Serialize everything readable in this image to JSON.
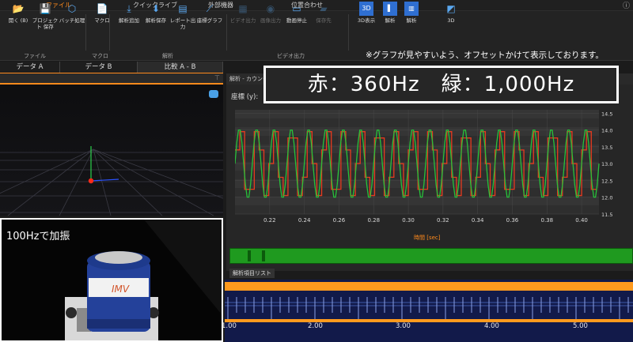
{
  "tabs": [
    "ファイル",
    "クイックライブ",
    "外部機器",
    "位置合わせ"
  ],
  "ribbon": {
    "buttons": [
      {
        "id": "open",
        "label": "開く (B)",
        "icon": "folder-open-icon"
      },
      {
        "id": "project-save",
        "label": "プロジェクト 保存",
        "icon": "save-icon"
      },
      {
        "id": "batch",
        "label": "バッチ処理",
        "icon": "cube-icon"
      },
      {
        "id": "macro",
        "label": "マクロ",
        "icon": "script-icon"
      },
      {
        "id": "add-analysis",
        "label": "解析追加",
        "icon": "download-icon"
      },
      {
        "id": "analysis-save",
        "label": "解析保存",
        "icon": "save-arrow-icon"
      },
      {
        "id": "report",
        "label": "レポート出力",
        "icon": "report-icon"
      },
      {
        "id": "coord-graph",
        "label": "座標グラフ",
        "icon": "xyz-graph-icon"
      },
      {
        "id": "video-out",
        "label": "ビデオ出力",
        "icon": "film-icon",
        "disabled": true
      },
      {
        "id": "image-out",
        "label": "画像出力",
        "icon": "camera-icon",
        "disabled": true
      },
      {
        "id": "record-stop",
        "label": "動画停止",
        "icon": "monitor-icon"
      },
      {
        "id": "save-dest",
        "label": "保存先",
        "icon": "folder-icon",
        "disabled": true
      },
      {
        "id": "view-3d",
        "label": "3D表示",
        "icon": "3d-icon"
      },
      {
        "id": "analysis",
        "label": "解析",
        "icon": "panel-icon"
      },
      {
        "id": "analysis2",
        "label": "解析",
        "icon": "columns-icon"
      },
      {
        "id": "3d-settings",
        "label": "3D",
        "icon": "settings-3d-icon"
      }
    ],
    "groups": [
      "ファイル",
      "マクロ",
      "解析",
      "ビデオ出力"
    ]
  },
  "note": "※グラフが見やすいよう、オフセットかけて表示しております。",
  "data_tabs": [
    "データ A",
    "データ B",
    "比較 A - B"
  ],
  "graph_panel_title": "解析 - カウンタ",
  "overlay_text": "赤：360Hz　緑：1,000Hz",
  "camera_label": "100Hzで加振",
  "graph_ylabel": "座標 (y):",
  "xaxis_title": "時間 [sec]",
  "analysis_list_tab": "解析項目リスト",
  "timeline_ticks": [
    "1.00",
    "2.00",
    "3.00",
    "4.00",
    "5.00"
  ],
  "colors": {
    "accent": "#ff8a1c",
    "red_series": "#e83a1e",
    "green_series": "#27c23a",
    "timeline_bg": "#121a4a"
  },
  "chart_data": {
    "type": "line",
    "xlabel": "時間 [sec]",
    "xlim": [
      0.2,
      0.41
    ],
    "x_ticks": [
      0.22,
      0.24,
      0.26,
      0.28,
      0.3,
      0.32,
      0.34,
      0.36,
      0.38,
      0.4
    ],
    "ylim": [
      11.5,
      14.6
    ],
    "y_ticks": [
      "14.5",
      "14.0",
      "13.5",
      "13.0",
      "12.5",
      "12.0",
      "11.5"
    ],
    "series": [
      {
        "name": "赤",
        "color": "#e83a1e",
        "frequency_hz": 100,
        "sample_rate_hz": 360,
        "center": 13.0,
        "amplitude": 0.95
      },
      {
        "name": "緑",
        "color": "#27c23a",
        "frequency_hz": 100,
        "sample_rate_hz": 1000,
        "center": 13.0,
        "amplitude": 1.05
      }
    ]
  }
}
